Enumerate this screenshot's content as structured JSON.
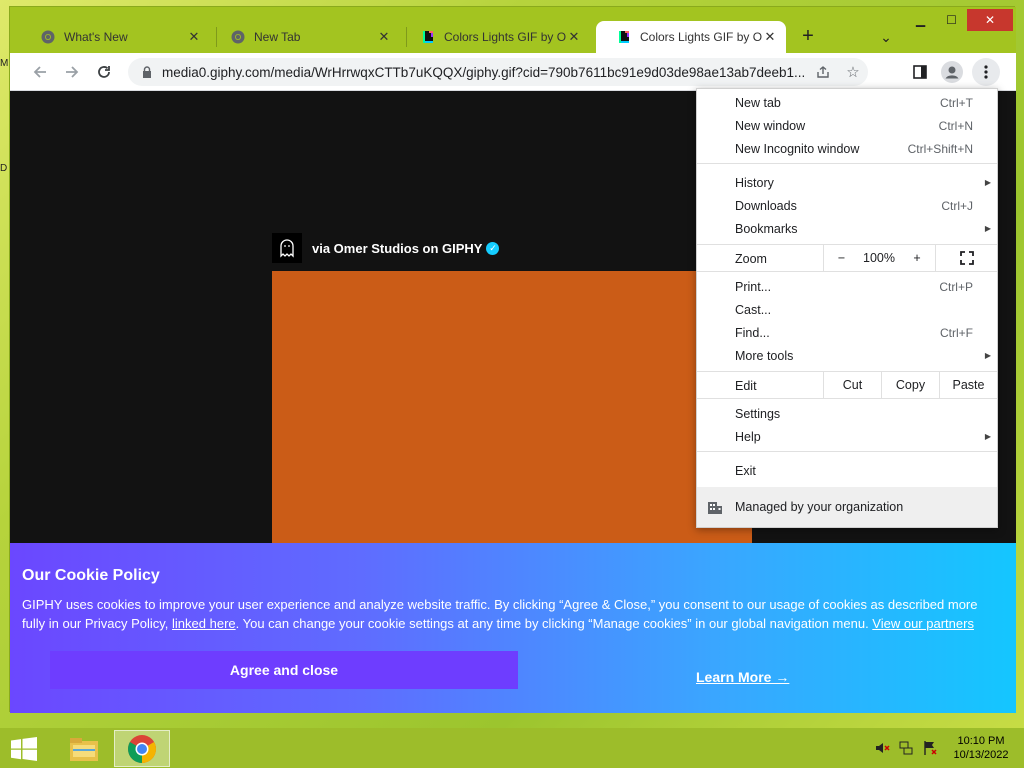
{
  "browser": {
    "tabs": [
      {
        "label": "What's New",
        "icon": "chrome-icon",
        "active": false
      },
      {
        "label": "New Tab",
        "icon": "chrome-icon",
        "active": false
      },
      {
        "label": "Colors Lights GIF by Om",
        "icon": "giphy-icon",
        "active": false
      },
      {
        "label": "Colors Lights GIF by Om",
        "icon": "giphy-icon",
        "active": true
      }
    ],
    "new_tab_symbol": "+",
    "url": "media0.giphy.com/media/WrHrrwqxCTTb7uKQQX/giphy.gif?cid=790b7611bc91e9d03de98ae13ab7deeb1..."
  },
  "giphy": {
    "attribution": "via Omer Studios on GIPHY",
    "gif_color": "#cb5c17"
  },
  "cookie": {
    "title": "Our Cookie Policy",
    "text_part1": "GIPHY uses cookies to improve your user experience and analyze website traffic. By clicking “Agree & Close,” you consent to our usage of cookies as described more fully in our Privacy Policy, ",
    "link1": "linked here",
    "text_part2": ". You can change your cookie settings at any time by clicking “Manage cookies” in our global navigation menu. ",
    "link2": "View our partners",
    "agree_label": "Agree and close",
    "learn_more_label": "Learn More →"
  },
  "menu": {
    "new_tab": {
      "label": "New tab",
      "shortcut": "Ctrl+T"
    },
    "new_window": {
      "label": "New window",
      "shortcut": "Ctrl+N"
    },
    "new_incognito": {
      "label": "New Incognito window",
      "shortcut": "Ctrl+Shift+N"
    },
    "history": {
      "label": "History"
    },
    "downloads": {
      "label": "Downloads",
      "shortcut": "Ctrl+J"
    },
    "bookmarks": {
      "label": "Bookmarks"
    },
    "zoom": {
      "label": "Zoom",
      "minus": "−",
      "value": "100%",
      "plus": "+"
    },
    "print": {
      "label": "Print...",
      "shortcut": "Ctrl+P"
    },
    "cast": {
      "label": "Cast..."
    },
    "find": {
      "label": "Find...",
      "shortcut": "Ctrl+F"
    },
    "more_tools": {
      "label": "More tools"
    },
    "edit": {
      "label": "Edit",
      "cut": "Cut",
      "copy": "Copy",
      "paste": "Paste"
    },
    "settings": {
      "label": "Settings"
    },
    "help": {
      "label": "Help"
    },
    "exit": {
      "label": "Exit"
    },
    "managed": {
      "label": "Managed by your organization"
    }
  },
  "desktop": {
    "icon_letter_1": "M",
    "icon_letter_2": "D"
  },
  "taskbar": {
    "time": "10:10 PM",
    "date": "10/13/2022"
  }
}
